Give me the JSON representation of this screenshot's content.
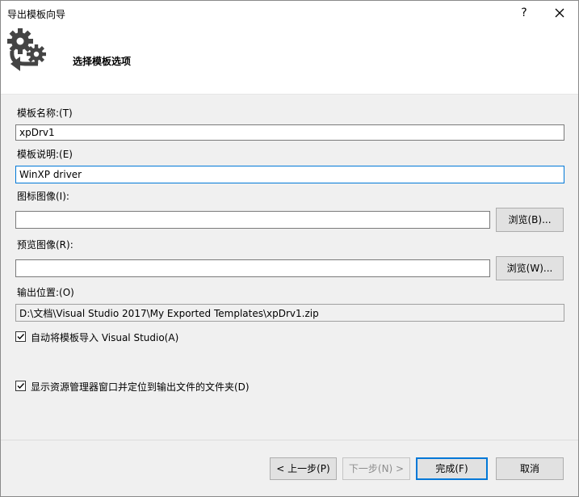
{
  "window": {
    "title": "导出模板向导",
    "help_icon": "?",
    "close_icon": "✕"
  },
  "header": {
    "title": "选择模板选项",
    "logo_icon": "gears-arrow-icon"
  },
  "form": {
    "template_name_label": "模板名称:(T)",
    "template_name_value": "xpDrv1",
    "template_desc_label": "模板说明:(E)",
    "template_desc_value": "WinXP driver",
    "icon_image_label": "图标图像(I):",
    "icon_image_value": "",
    "icon_browse_label": "浏览(B)...",
    "preview_image_label": "预览图像(R):",
    "preview_image_value": "",
    "preview_browse_label": "浏览(W)...",
    "output_location_label": "输出位置:(O)",
    "output_location_value": "D:\\文档\\Visual Studio 2017\\My Exported Templates\\xpDrv1.zip",
    "auto_import_label": "自动将模板导入 Visual Studio(A)",
    "auto_import_checked": true,
    "show_explorer_label": "显示资源管理器窗口并定位到输出文件的文件夹(D)",
    "show_explorer_checked": true
  },
  "footer": {
    "back_label": "< 上一步(P)",
    "next_label": "下一步(N) >",
    "finish_label": "完成(F)",
    "cancel_label": "取消"
  },
  "colors": {
    "accent": "#0078d7",
    "header_bg": "#ffffff",
    "body_bg": "#f0f0f0",
    "logo": "#444444"
  }
}
